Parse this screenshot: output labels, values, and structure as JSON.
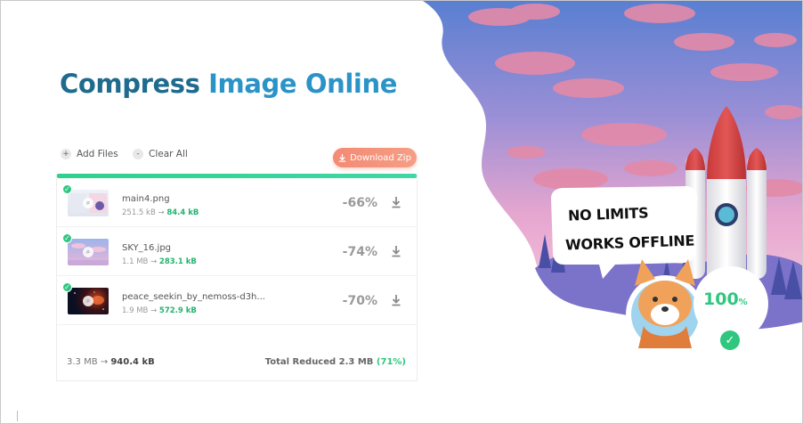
{
  "page": {
    "title_part1": "Compress ",
    "title_part2": "Image Online"
  },
  "toolbar": {
    "add_files_label": "Add Files",
    "add_files_icon": "+",
    "clear_all_label": "Clear All",
    "clear_all_icon": "-",
    "download_zip_label": "Download Zip"
  },
  "progress": {
    "value": 1.0
  },
  "files": [
    {
      "name": "main4.png",
      "original": "251.5 kB",
      "compressed": "84.4 kB",
      "reduction": "-66%",
      "thumb": "screenshot"
    },
    {
      "name": "SKY_16.jpg",
      "original": "1.1 MB",
      "compressed": "283.1 kB",
      "reduction": "-74%",
      "thumb": "sky"
    },
    {
      "name": "peace_seekin_by_nemoss-d3h...",
      "original": "1.9 MB",
      "compressed": "572.9 kB",
      "reduction": "-70%",
      "thumb": "space"
    }
  ],
  "summary": {
    "original_total": "3.3 MB",
    "arrow": "→",
    "compressed_total": "940.4 kB",
    "total_reduced_label": "Total Reduced 2.3 MB",
    "total_reduced_percent": "(71%)"
  },
  "promo": {
    "line1": "NO LIMITS",
    "line2": "WORKS OFFLINE",
    "percent_value": "100",
    "percent_sign": "%"
  },
  "colors": {
    "title_dark": "#1f6b8e",
    "title_light": "#2a93c7",
    "accent_green": "#2fc77f",
    "download_zip": "#f48a73"
  }
}
